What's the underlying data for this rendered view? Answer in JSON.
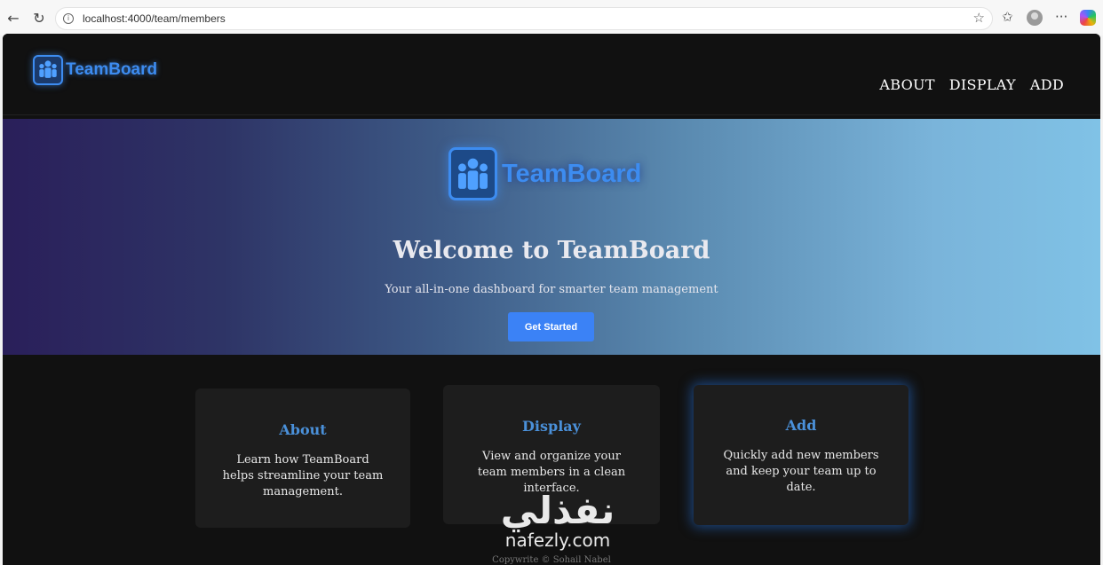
{
  "browser": {
    "url": "localhost:4000/team/members"
  },
  "header": {
    "logo_text": "TeamBoard",
    "nav": [
      "ABOUT",
      "DISPLAY",
      "ADD"
    ]
  },
  "hero": {
    "logo_text": "TeamBoard",
    "title": "Welcome to TeamBoard",
    "subtitle": "Your all-in-one dashboard for smarter team management",
    "cta_label": "Get Started"
  },
  "cards": [
    {
      "title": "About",
      "text": "Learn how TeamBoard helps streamline your team management."
    },
    {
      "title": "Display",
      "text": "View and organize your team members in a clean interface."
    },
    {
      "title": "Add",
      "text": "Quickly add new members and keep your team up to date."
    }
  ],
  "footer": {
    "text": "Copywrite © Sohail Nabel"
  },
  "watermark": {
    "arabic": "نفذلي",
    "latin": "nafezly.com"
  },
  "colors": {
    "accent": "#3d8cf0",
    "button": "#3b82f6",
    "page_bg": "#111111",
    "card_bg": "#1d1d1d"
  }
}
